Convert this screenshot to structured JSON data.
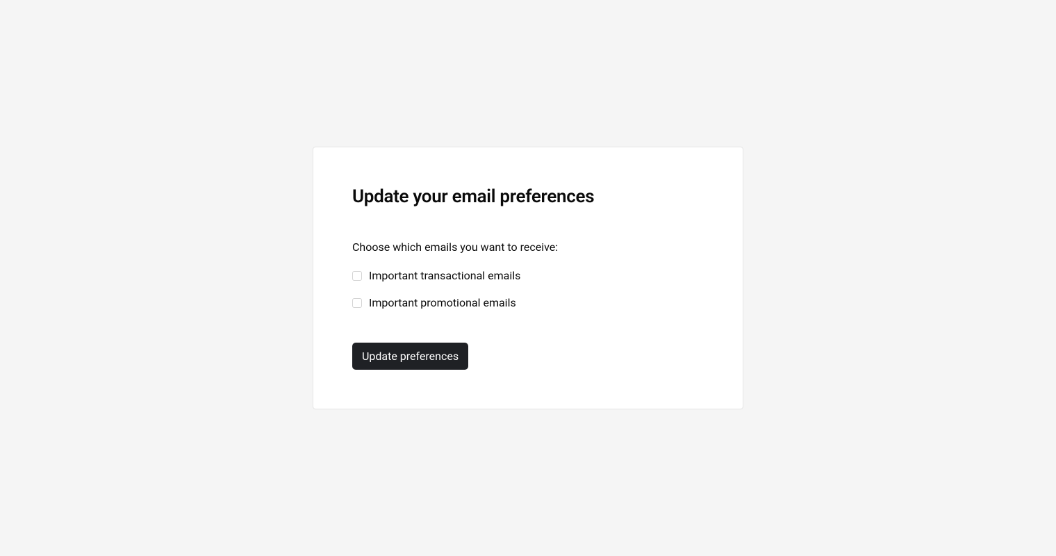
{
  "heading": "Update your email preferences",
  "subtitle": "Choose which emails you want to receive:",
  "options": [
    {
      "label": "Important transactional emails",
      "checked": false
    },
    {
      "label": "Important promotional emails",
      "checked": false
    }
  ],
  "submit_label": "Update preferences"
}
